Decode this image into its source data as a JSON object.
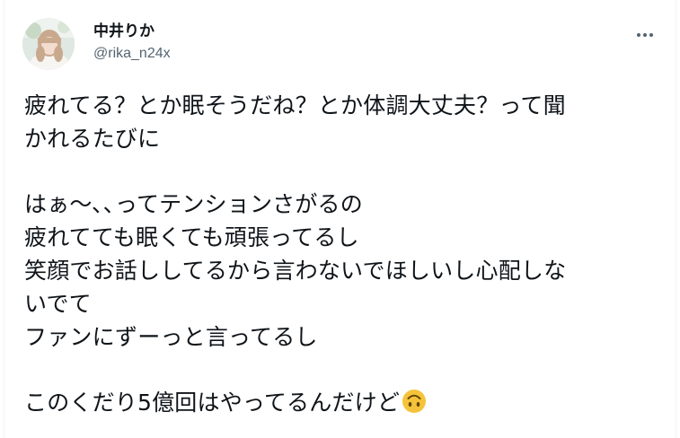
{
  "author": {
    "display_name": "中井りか",
    "handle": "@rika_n24x"
  },
  "tweet": {
    "lines": [
      "疲れてる？とか眠そうだね？とか体調大丈夫？って聞",
      "かれるたびに",
      "",
      "はぁ〜､､ってテンションさがるの",
      "疲れてても眠くても頑張ってるし",
      "笑顔でお話ししてるから言わないでほしいし心配しな",
      "いでて",
      "ファンにずーっと言ってるし",
      "",
      "このくだり5億回はやってるんだけど"
    ],
    "trailing_emoji": "upside-down-face"
  },
  "icons": {
    "more": "more-dots-icon",
    "avatar": "user-avatar"
  },
  "colors": {
    "text": "#0f1419",
    "secondary": "#536471",
    "emoji": "#f5c33b"
  }
}
